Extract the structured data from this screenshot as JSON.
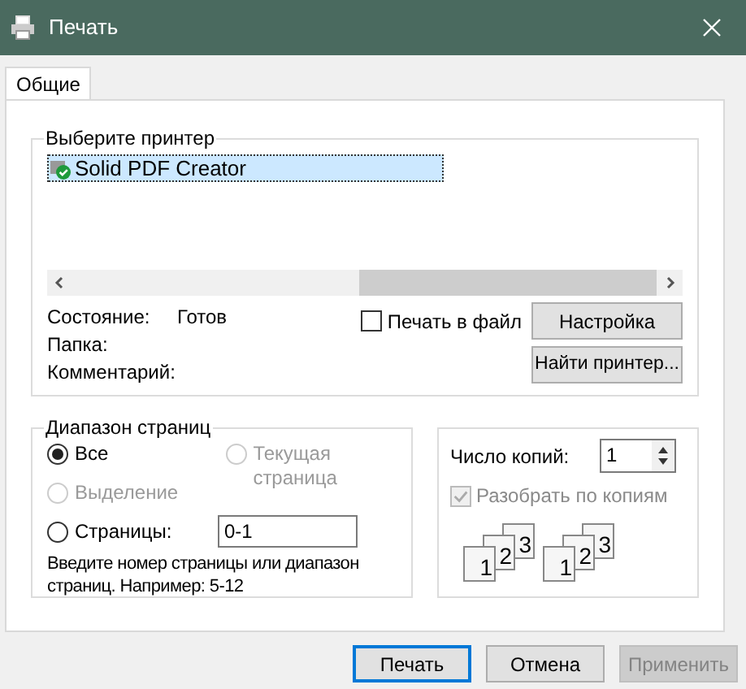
{
  "window": {
    "title": "Печать"
  },
  "tabs": [
    {
      "label": "Общие",
      "selected": true
    }
  ],
  "printer_group": {
    "title": "Выберите принтер",
    "printers": [
      {
        "name": "Solid PDF Creator",
        "selected": true
      }
    ]
  },
  "status": [
    {
      "label": "Состояние:",
      "value": "Готов"
    },
    {
      "label": "Папка:"
    },
    {
      "label": "Комментарий:"
    }
  ],
  "print_to_file": {
    "label": "Печать в файл",
    "checked": false
  },
  "printer_buttons": [
    {
      "label": "Настройка"
    },
    {
      "label": "Найти принтер..."
    }
  ],
  "page_range": {
    "title": "Диапазон страниц",
    "options": [
      {
        "label": "Все",
        "selected": true,
        "disabled": false
      },
      {
        "label": "Текущая страница",
        "selected": false,
        "disabled": true
      },
      {
        "label": "Выделение",
        "selected": false,
        "disabled": true
      },
      {
        "label": "Страницы:",
        "selected": false,
        "disabled": false
      }
    ],
    "pages_value": "0-1",
    "hint": "Введите номер страницы или диапазон страниц.  Например: 5-12"
  },
  "copies": {
    "label": "Число копий:",
    "value": "1",
    "collate": {
      "label": "Разобрать по копиям",
      "checked": true,
      "disabled": true
    },
    "stacks": [
      [
        "1",
        "2",
        "3"
      ],
      [
        "1",
        "2",
        "3"
      ]
    ]
  },
  "buttons": [
    {
      "label": "Печать",
      "default": true,
      "disabled": false
    },
    {
      "label": "Отмена",
      "default": false,
      "disabled": false
    },
    {
      "label": "Применить",
      "default": false,
      "disabled": true
    }
  ]
}
